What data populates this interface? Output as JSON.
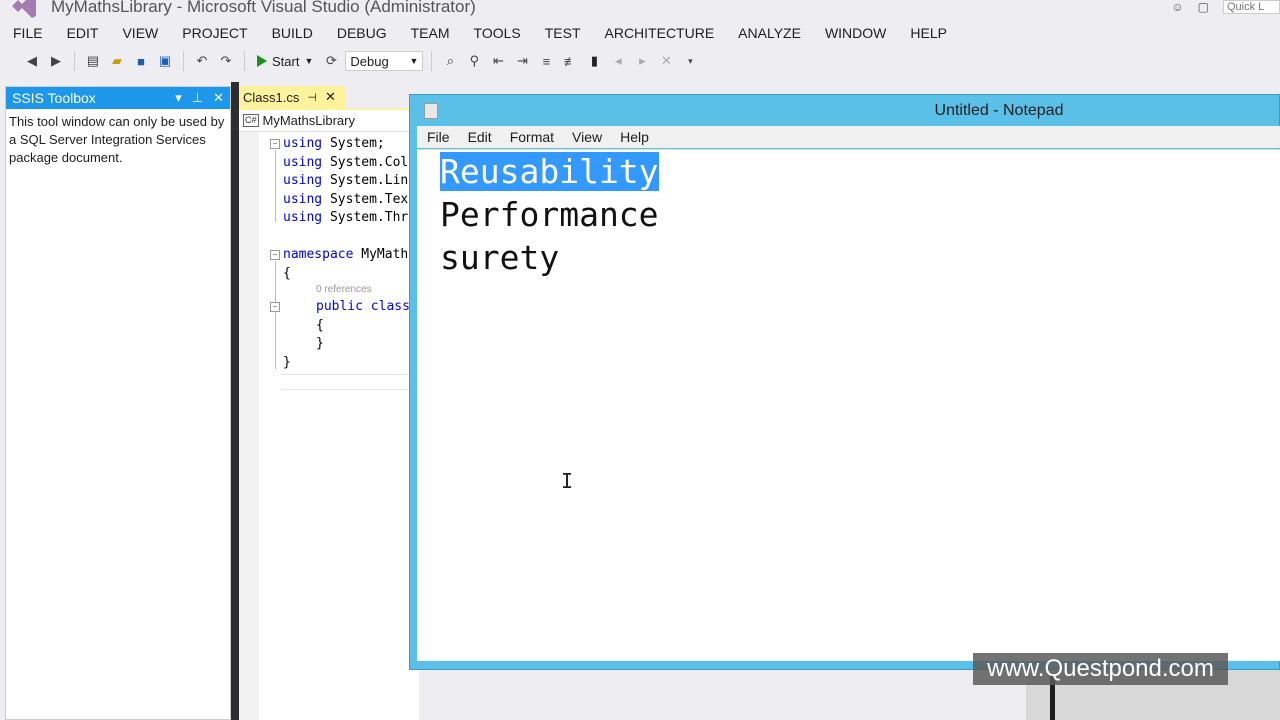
{
  "window": {
    "title": "MyMathsLibrary - Microsoft Visual Studio (Administrator)",
    "quick_launch": "Quick L"
  },
  "menu": [
    "FILE",
    "EDIT",
    "VIEW",
    "PROJECT",
    "BUILD",
    "DEBUG",
    "TEAM",
    "TOOLS",
    "TEST",
    "ARCHITECTURE",
    "ANALYZE",
    "WINDOW",
    "HELP"
  ],
  "toolbar": {
    "start_label": "Start",
    "configuration": "Debug"
  },
  "ssis_toolbox": {
    "title": "SSIS Toolbox",
    "message": "This tool window can only be used by a SQL Server Integration Services package document."
  },
  "editor": {
    "tab_label": "Class1.cs",
    "nav_project": "MyMathsLibrary",
    "code": {
      "l1_kw": "using",
      "l1_rest": " System;",
      "l2_kw": "using",
      "l2_rest": " System.Col",
      "l3_kw": "using",
      "l3_rest": " System.Lin",
      "l4_kw": "using",
      "l4_rest": " System.Tex",
      "l5_kw": "using",
      "l5_rest": " System.Thr",
      "l6_kw": "namespace",
      "l6_rest": " MyMath",
      "l7": "{",
      "codelens": "0 references",
      "l8_kw": "public",
      "l8_kw2": " class",
      "l9": "{",
      "l10": "}",
      "l11": "}"
    }
  },
  "notepad": {
    "title": "Untitled - Notepad",
    "menu": [
      "File",
      "Edit",
      "Format",
      "View",
      "Help"
    ],
    "lines": [
      "Reusability",
      "Performance",
      "surety"
    ]
  },
  "watermark": "www.Questpond.com",
  "colors": {
    "vs_accent": "#1c97ea",
    "notepad_frame": "#5bc0e8",
    "selection": "#3399ff",
    "keyword": "#0000ff",
    "active_tab": "#fff29d"
  }
}
